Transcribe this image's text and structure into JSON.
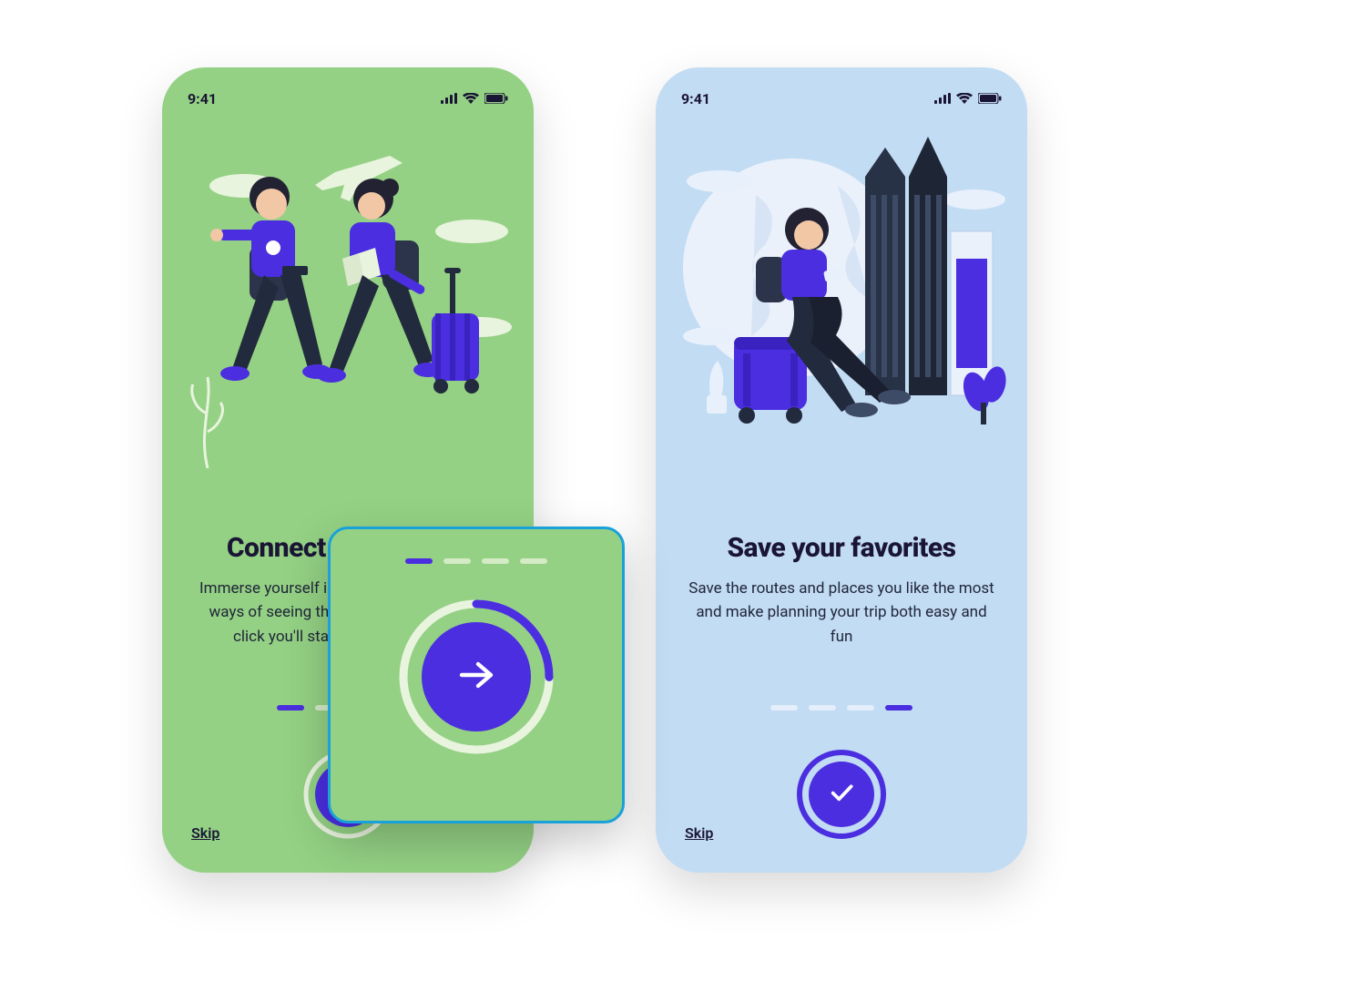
{
  "colors": {
    "accent": "#4a2ee0",
    "text": "#1a1535",
    "screenA_bg": "#94d184",
    "screenB_bg": "#c2dcf3",
    "zoom_border": "#1aa1da"
  },
  "status": {
    "time": "9:41",
    "signal_icon": "signal-icon",
    "wifi_icon": "wifi-icon",
    "battery_icon": "battery-icon"
  },
  "screens": [
    {
      "id": "connect",
      "title": "Connect with people",
      "body": "Immerse yourself in other cultures and new ways of seeing the world ... with just one click you'll start a new experience",
      "active_dot_index": 0,
      "dot_count": 4,
      "progress_fraction": 0.25,
      "next_action_icon": "arrow-right-icon",
      "skip_label": "Skip"
    },
    {
      "id": "favorites",
      "title": "Save your favorites",
      "body": "Save the routes and places you like the most and make planning your trip both easy and fun",
      "active_dot_index": 3,
      "dot_count": 4,
      "progress_fraction": 1.0,
      "next_action_icon": "check-icon",
      "skip_label": "Skip"
    }
  ],
  "zoom_preview": {
    "based_on_screen": 0,
    "dot_count": 4,
    "active_dot_index": 0,
    "progress_fraction": 0.25,
    "action_icon": "arrow-right-icon"
  }
}
